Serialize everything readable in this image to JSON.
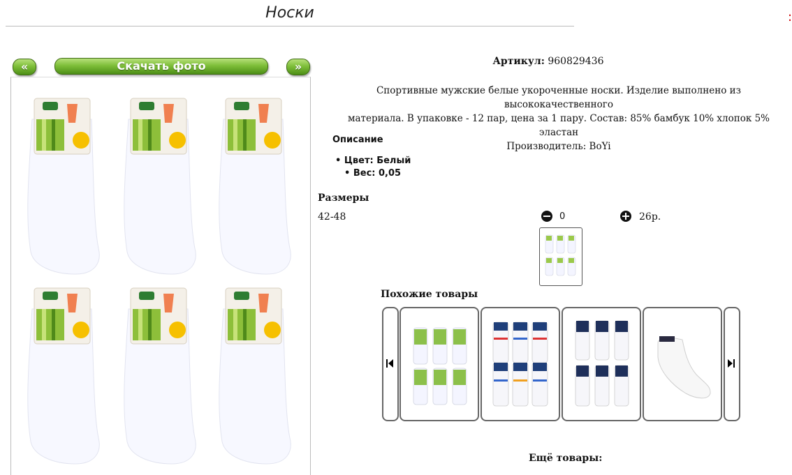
{
  "page": {
    "title": "Носки",
    "corner_mark": ":"
  },
  "gallery": {
    "prev_label": "«",
    "download_label": "Скачать фото",
    "next_label": "»"
  },
  "product": {
    "article_label": "Артикул:",
    "article_value": "960829436",
    "description_lines": [
      "Спортивные мужские белые укороченные носки. Изделие выполнено из высококачественного",
      "материала. В упаковке - 12 пар, цена за 1 пару. Состав: 85% бамбук 10% хлопок 5% эластан",
      "Производитель: BoYi"
    ],
    "description_heading": "Описание",
    "properties": [
      "Цвет: Белый",
      "Вес: 0,05"
    ]
  },
  "sizes": {
    "heading": "Размеры",
    "rows": [
      {
        "size": "42-48",
        "quantity": "0",
        "price": "26р."
      }
    ]
  },
  "similar": {
    "heading": "Похожие товары"
  },
  "more": {
    "heading": "Ещё товары:"
  },
  "colors": {
    "button_green": "#6fae2e",
    "card_border": "#666666"
  },
  "icons": [
    "minus-circle-icon",
    "plus-circle-icon",
    "skip-back-icon",
    "skip-forward-icon"
  ]
}
